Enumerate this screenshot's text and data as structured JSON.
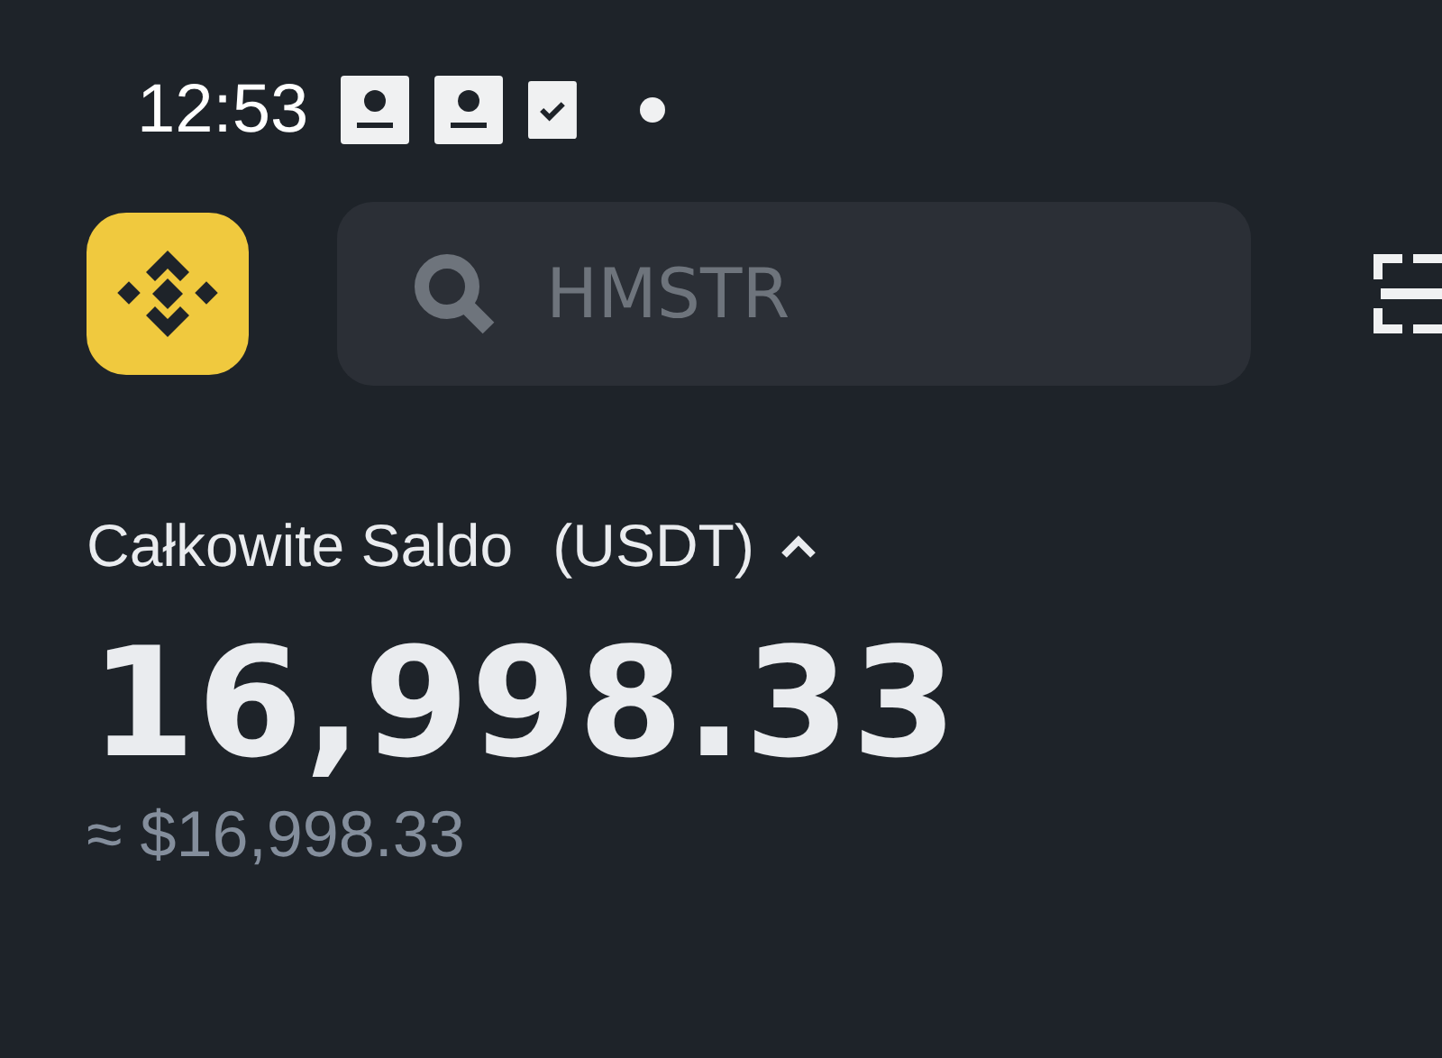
{
  "status_bar": {
    "time": "12:53"
  },
  "search": {
    "placeholder": "HMSTR"
  },
  "balance": {
    "label": "Całkowite Saldo",
    "currency": "(USDT)",
    "expanded": true,
    "amount": "16,998.33",
    "approx": "≈ $16,998.33"
  }
}
